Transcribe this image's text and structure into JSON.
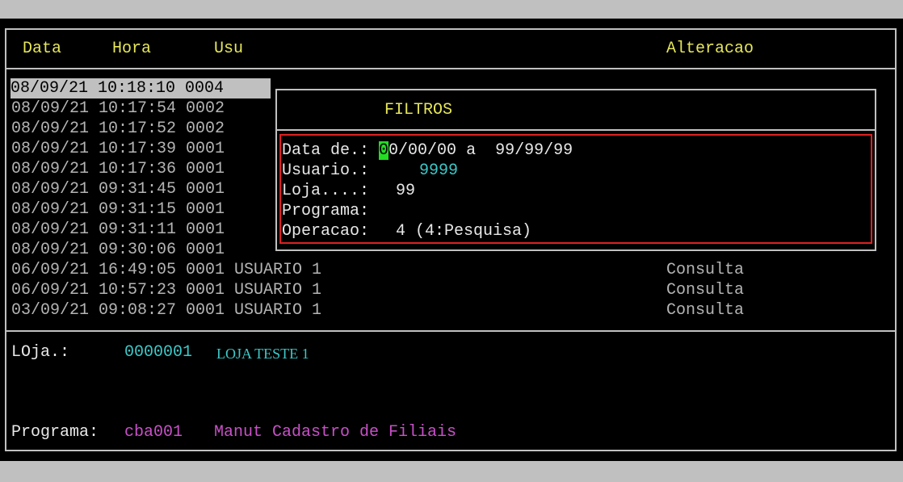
{
  "header": {
    "col_data": "Data",
    "col_hora": "Hora",
    "col_usu": "Usu",
    "col_alteracao": "Alteracao"
  },
  "log_rows": [
    {
      "text": "08/09/21 10:18:10 0004",
      "alteracao": ""
    },
    {
      "text": "08/09/21 10:17:54 0002",
      "alteracao": ""
    },
    {
      "text": "08/09/21 10:17:52 0002",
      "alteracao": ""
    },
    {
      "text": "08/09/21 10:17:39 0001",
      "alteracao": ""
    },
    {
      "text": "08/09/21 10:17:36 0001",
      "alteracao": ""
    },
    {
      "text": "08/09/21 09:31:45 0001",
      "alteracao": ""
    },
    {
      "text": "08/09/21 09:31:15 0001",
      "alteracao": ""
    },
    {
      "text": "08/09/21 09:31:11 0001",
      "alteracao": ""
    },
    {
      "text": "08/09/21 09:30:06 0001",
      "alteracao": ""
    },
    {
      "text": "06/09/21 16:49:05 0001 USUARIO 1",
      "alteracao": "Consulta"
    },
    {
      "text": "06/09/21 10:57:23 0001 USUARIO 1",
      "alteracao": "Consulta"
    },
    {
      "text": "03/09/21 09:08:27 0001 USUARIO 1",
      "alteracao": "Consulta"
    }
  ],
  "filter": {
    "title": "FILTROS",
    "data_label": "Data de.: ",
    "data_cursor_char": "0",
    "data_from_rest": "0/00/00",
    "data_sep": " a  ",
    "data_to": "99/99/99",
    "usuario_label": "Usuario.:",
    "usuario_value": "9999",
    "loja_label": "Loja....:",
    "loja_value": "99",
    "programa_label": "Programa:",
    "operacao_label": "Operacao:",
    "operacao_value": "4 (4:Pesquisa)"
  },
  "details": {
    "loja_label": "LOja.:",
    "loja_code": "0000001",
    "loja_name": "LOJA TESTE 1",
    "programa_label": "Programa:",
    "programa_code": "cba001",
    "programa_desc": "Manut Cadastro de Filiais"
  },
  "colors": {
    "header": "#e6e65a",
    "cyan": "#3cc8c8",
    "magenta": "#c850c8",
    "highlight_border": "#e02020",
    "cursor": "#22dd22"
  }
}
